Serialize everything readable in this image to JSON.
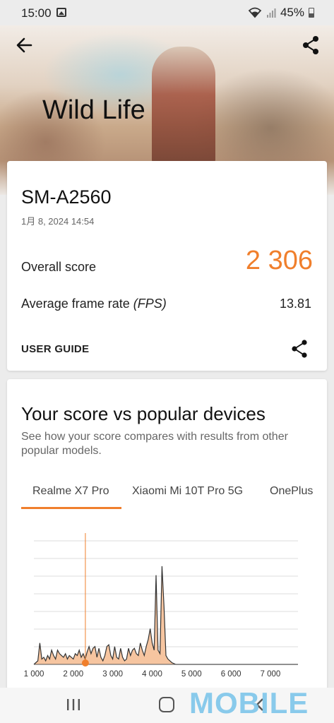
{
  "status_bar": {
    "time": "15:00",
    "battery": "45%"
  },
  "header": {
    "title": "Wild Life",
    "back_icon": "arrow-left-icon",
    "share_icon": "share-icon"
  },
  "result": {
    "device": "SM-A2560",
    "date": "1月 8, 2024 14:54",
    "overall_label": "Overall score",
    "overall_value": "2 306",
    "fps_label": "Average frame rate",
    "fps_unit": "(FPS)",
    "fps_value": "13.81",
    "guide_label": "USER GUIDE"
  },
  "comparison": {
    "title": "Your score vs popular devices",
    "subtitle": "See how your score compares with results from other popular models.",
    "tabs": [
      {
        "label": "Realme X7 Pro",
        "active": true
      },
      {
        "label": "Xiaomi Mi 10T Pro 5G",
        "active": false
      },
      {
        "label": "OnePlus",
        "active": false
      }
    ]
  },
  "chart_data": {
    "type": "area",
    "x_ticks": [
      "1 000",
      "2 000",
      "3 000",
      "4 000",
      "5 000",
      "6 000",
      "7 000"
    ],
    "xlim": [
      1000,
      7700
    ],
    "your_score": 2306,
    "x": [
      1000,
      1100,
      1150,
      1200,
      1250,
      1300,
      1350,
      1400,
      1450,
      1500,
      1550,
      1600,
      1650,
      1700,
      1750,
      1800,
      1850,
      1900,
      1950,
      2000,
      2050,
      2100,
      2150,
      2200,
      2250,
      2300,
      2350,
      2400,
      2450,
      2500,
      2550,
      2600,
      2650,
      2700,
      2750,
      2800,
      2850,
      2900,
      2950,
      3000,
      3050,
      3100,
      3150,
      3200,
      3250,
      3300,
      3350,
      3400,
      3450,
      3500,
      3550,
      3600,
      3650,
      3700,
      3750,
      3800,
      3850,
      3900,
      3950,
      4000,
      4050,
      4100,
      4150,
      4200,
      4250,
      4300,
      4350,
      4400,
      4450,
      4500,
      4600,
      5000,
      6000,
      7000,
      7700
    ],
    "y": [
      0,
      2,
      12,
      3,
      4,
      2,
      5,
      3,
      8,
      5,
      3,
      8,
      6,
      5,
      4,
      6,
      3,
      5,
      4,
      3,
      6,
      5,
      8,
      4,
      6,
      3,
      7,
      10,
      6,
      9,
      10,
      4,
      9,
      4,
      2,
      5,
      10,
      11,
      5,
      3,
      10,
      4,
      3,
      9,
      4,
      2,
      3,
      9,
      5,
      8,
      9,
      6,
      5,
      12,
      8,
      5,
      10,
      14,
      20,
      12,
      8,
      50,
      8,
      6,
      55,
      33,
      5,
      3,
      2,
      1,
      0,
      0,
      0,
      0,
      0
    ],
    "ylim": [
      0,
      70
    ],
    "grid": true,
    "colors": {
      "fill": "#f6c5a0",
      "line": "#333333",
      "marker": "#f07f2c",
      "grid": "#dddddd"
    }
  },
  "nav_bar": {
    "recent_icon": "recent-apps-icon",
    "home_icon": "home-icon",
    "back_icon": "back-chevron-icon"
  },
  "watermark": "MOBILE"
}
